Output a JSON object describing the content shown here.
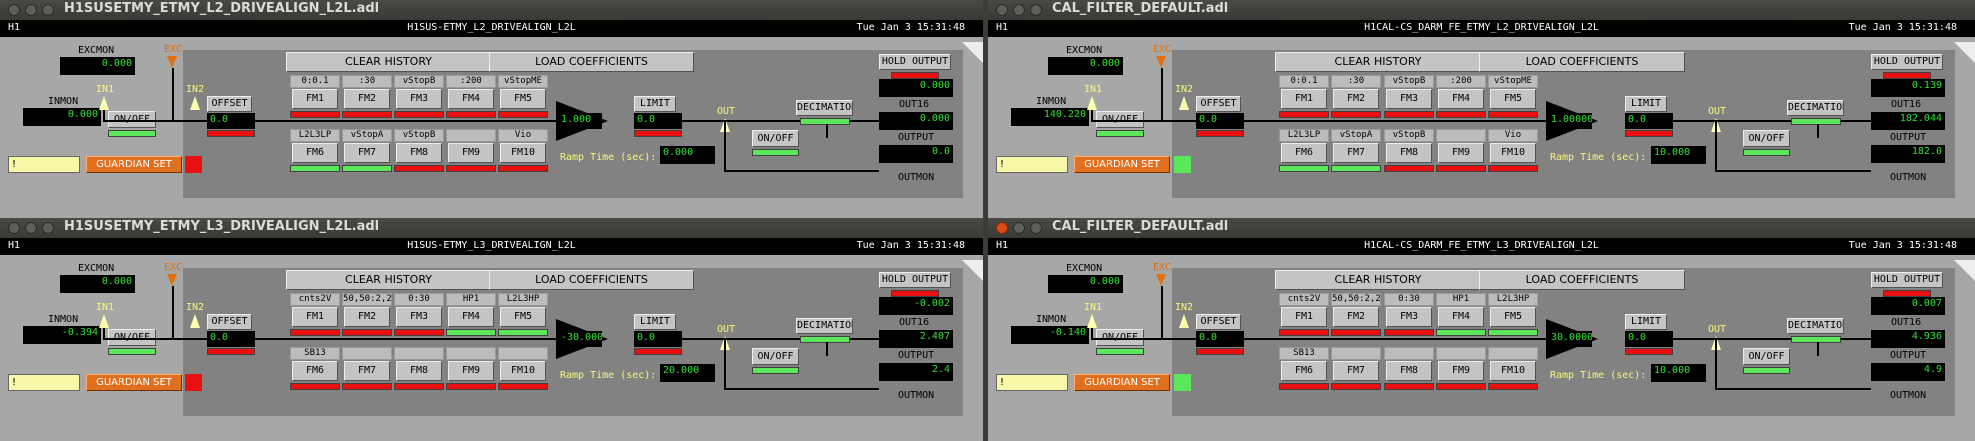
{
  "screen": {
    "bg_color": "#3c3b37"
  },
  "windows": [
    {
      "title": "H1SUSETMY_ETMY_L2_DRIVEALIGN_L2L.adl",
      "active": false,
      "header": {
        "site": "H1",
        "channel": "H1SUS-ETMY_L2_DRIVEALIGN_L2L",
        "time": "Tue Jan  3 15:31:48"
      },
      "excmon": {
        "label": "EXCMON",
        "value": "0.000"
      },
      "inmon": {
        "label": "INMON",
        "value": "0.000"
      },
      "exc": "EXC",
      "in1": "IN1",
      "in2": "IN2",
      "onoff_in": "ON/OFF",
      "onoff_in_ind": "g",
      "offset": {
        "label": "OFFSET",
        "value": "0.0",
        "ind": "r"
      },
      "clear_history": "CLEAR HISTORY",
      "load_coefficients": "LOAD COEFFICIENTS",
      "fm_names_top": [
        "0:0.1",
        ":30",
        "vStopB",
        ":200",
        "vStopME"
      ],
      "fm_top": [
        "FM1",
        "FM2",
        "FM3",
        "FM4",
        "FM5"
      ],
      "fm_top_ind": [
        "r",
        "r",
        "r",
        "r",
        "r"
      ],
      "fm_names_bot": [
        "L2L3LP",
        "vStopA",
        "vStopB",
        "",
        "Vio"
      ],
      "fm_bot": [
        "FM6",
        "FM7",
        "FM8",
        "FM9",
        "FM10"
      ],
      "fm_bot_ind": [
        "g",
        "g",
        "r",
        "r",
        "r"
      ],
      "gain": "1.000",
      "limit": {
        "label": "LIMIT",
        "value": "0.0",
        "ind": "r"
      },
      "out": "OUT",
      "onoff_out": "ON/OFF",
      "onoff_out_ind": "g",
      "decimation": "DECIMATION",
      "decimation_ind": "g",
      "hold_output": "HOLD OUTPUT",
      "hold_ind": "r",
      "hold_value": "0.000",
      "out16_label": "OUT16",
      "out16_value": "0.000",
      "output_label": "OUTPUT",
      "output_value": "0.0",
      "outmon_label": "OUTMON",
      "ramp": {
        "label": "Ramp Time (sec):",
        "value": "0.000"
      },
      "note": "!",
      "guardian": "GUARDIAN SET",
      "guardian_ind": "r"
    },
    {
      "title": "CAL_FILTER_DEFAULT.adl",
      "active": false,
      "header": {
        "site": "H1",
        "channel": "H1CAL-CS_DARM_FE_ETMY_L2_DRIVEALIGN_L2L",
        "time": "Tue Jan  3 15:31:48"
      },
      "excmon": {
        "label": "EXCMON",
        "value": "0.000"
      },
      "inmon": {
        "label": "INMON",
        "value": "140.220"
      },
      "exc": "EXC",
      "in1": "IN1",
      "in2": "IN2",
      "onoff_in": "ON/OFF",
      "onoff_in_ind": "g",
      "offset": {
        "label": "OFFSET",
        "value": "0.0",
        "ind": "r"
      },
      "clear_history": "CLEAR HISTORY",
      "load_coefficients": "LOAD COEFFICIENTS",
      "fm_names_top": [
        "0:0.1",
        ":30",
        "vStopB",
        ":200",
        "vStopME"
      ],
      "fm_top": [
        "FM1",
        "FM2",
        "FM3",
        "FM4",
        "FM5"
      ],
      "fm_top_ind": [
        "r",
        "r",
        "r",
        "r",
        "r"
      ],
      "fm_names_bot": [
        "L2L3LP",
        "vStopA",
        "vStopB",
        "",
        "Vio"
      ],
      "fm_bot": [
        "FM6",
        "FM7",
        "FM8",
        "FM9",
        "FM10"
      ],
      "fm_bot_ind": [
        "g",
        "g",
        "r",
        "r",
        "r"
      ],
      "gain": "1.00000",
      "limit": {
        "label": "LIMIT",
        "value": "0.0",
        "ind": "r"
      },
      "out": "OUT",
      "onoff_out": "ON/OFF",
      "onoff_out_ind": "g",
      "decimation": "DECIMATION",
      "decimation_ind": "g",
      "hold_output": "HOLD OUTPUT",
      "hold_ind": "r",
      "hold_value": "0.139",
      "out16_label": "OUT16",
      "out16_value": "182.044",
      "output_label": "OUTPUT",
      "output_value": "182.0",
      "outmon_label": "OUTMON",
      "ramp": {
        "label": "Ramp Time (sec):",
        "value": "10.000"
      },
      "note": "!",
      "guardian": "GUARDIAN SET",
      "guardian_ind": "g"
    },
    {
      "title": "H1SUSETMY_ETMY_L3_DRIVEALIGN_L2L.adl",
      "active": false,
      "header": {
        "site": "H1",
        "channel": "H1SUS-ETMY_L3_DRIVEALIGN_L2L",
        "time": "Tue Jan  3 15:31:48"
      },
      "excmon": {
        "label": "EXCMON",
        "value": "0.000"
      },
      "inmon": {
        "label": "INMON",
        "value": "-0.394"
      },
      "exc": "EXC",
      "in1": "IN1",
      "in2": "IN2",
      "onoff_in": "ON/OFF",
      "onoff_in_ind": "g",
      "offset": {
        "label": "OFFSET",
        "value": "0.0",
        "ind": "r"
      },
      "clear_history": "CLEAR HISTORY",
      "load_coefficients": "LOAD COEFFICIENTS",
      "fm_names_top": [
        "cnts2V",
        "50,50:2,2",
        "0:30",
        "HP1",
        "L2L3HP"
      ],
      "fm_top": [
        "FM1",
        "FM2",
        "FM3",
        "FM4",
        "FM5"
      ],
      "fm_top_ind": [
        "r",
        "r",
        "r",
        "g",
        "g"
      ],
      "fm_names_bot": [
        "SB13",
        "",
        "",
        "",
        ""
      ],
      "fm_bot": [
        "FM6",
        "FM7",
        "FM8",
        "FM9",
        "FM10"
      ],
      "fm_bot_ind": [
        "r",
        "r",
        "r",
        "r",
        "r"
      ],
      "gain": "-30.000",
      "limit": {
        "label": "LIMIT",
        "value": "0.0",
        "ind": "r"
      },
      "out": "OUT",
      "onoff_out": "ON/OFF",
      "onoff_out_ind": "g",
      "decimation": "DECIMATION",
      "decimation_ind": "g",
      "hold_output": "HOLD OUTPUT",
      "hold_ind": "r",
      "hold_value": "-0.002",
      "out16_label": "OUT16",
      "out16_value": "2.407",
      "output_label": "OUTPUT",
      "output_value": "2.4",
      "outmon_label": "OUTMON",
      "ramp": {
        "label": "Ramp Time (sec):",
        "value": "20.000"
      },
      "note": "!",
      "guardian": "GUARDIAN SET",
      "guardian_ind": "r"
    },
    {
      "title": "CAL_FILTER_DEFAULT.adl",
      "active": true,
      "header": {
        "site": "H1",
        "channel": "H1CAL-CS_DARM_FE_ETMY_L3_DRIVEALIGN_L2L",
        "time": "Tue Jan  3 15:31:48"
      },
      "excmon": {
        "label": "EXCMON",
        "value": "0.000"
      },
      "inmon": {
        "label": "INMON",
        "value": "-0.140"
      },
      "exc": "EXC",
      "in1": "IN1",
      "in2": "IN2",
      "onoff_in": "ON/OFF",
      "onoff_in_ind": "g",
      "offset": {
        "label": "OFFSET",
        "value": "0.0",
        "ind": "r"
      },
      "clear_history": "CLEAR HISTORY",
      "load_coefficients": "LOAD COEFFICIENTS",
      "fm_names_top": [
        "cnts2V",
        "50,50:2,2",
        "0:30",
        "HP1",
        "L2L3HP"
      ],
      "fm_top": [
        "FM1",
        "FM2",
        "FM3",
        "FM4",
        "FM5"
      ],
      "fm_top_ind": [
        "r",
        "r",
        "r",
        "g",
        "g"
      ],
      "fm_names_bot": [
        "SB13",
        "",
        "",
        "",
        ""
      ],
      "fm_bot": [
        "FM6",
        "FM7",
        "FM8",
        "FM9",
        "FM10"
      ],
      "fm_bot_ind": [
        "r",
        "r",
        "r",
        "r",
        "r"
      ],
      "gain": "30.0000",
      "limit": {
        "label": "LIMIT",
        "value": "0.0",
        "ind": "r"
      },
      "out": "OUT",
      "onoff_out": "ON/OFF",
      "onoff_out_ind": "g",
      "decimation": "DECIMATION",
      "decimation_ind": "g",
      "hold_output": "HOLD OUTPUT",
      "hold_ind": "r",
      "hold_value": "0.007",
      "out16_label": "OUT16",
      "out16_value": "4.936",
      "output_label": "OUTPUT",
      "output_value": "4.9",
      "outmon_label": "OUTMON",
      "ramp": {
        "label": "Ramp Time (sec):",
        "value": "10.000"
      },
      "note": "!",
      "guardian": "GUARDIAN SET",
      "guardian_ind": "g"
    }
  ]
}
